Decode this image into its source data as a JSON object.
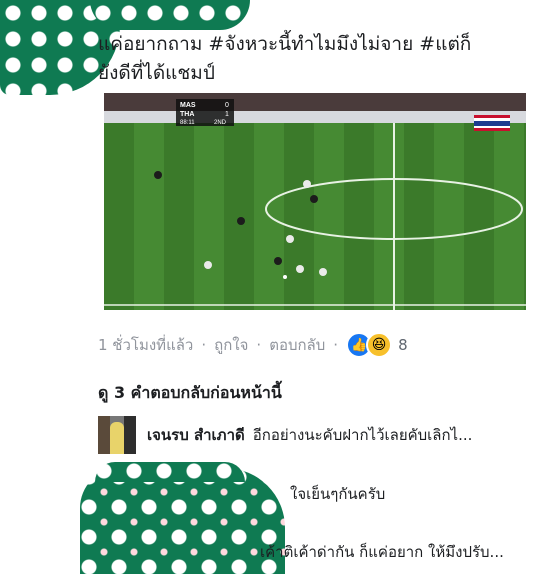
{
  "comment": {
    "text_line1_plain": "แค่อยากถาม ",
    "tag1": "#จังหวะนี้ทำไมมึงไม่จาย",
    "tag2": " #แต่ก็",
    "text_line2": "ยังดีที่ได้แชมป์"
  },
  "video": {
    "score_team1": "MAS",
    "score_val1": "0",
    "score_team2": "THA",
    "score_val2": "1",
    "time": "88:11",
    "half": "2ND"
  },
  "meta": {
    "time_ago": "1 ชั่วโมงที่แล้ว",
    "like": "ถูกใจ",
    "reply": "ตอบกลับ",
    "like_icon": "👍",
    "haha_icon": "😆",
    "reaction_count": "8"
  },
  "previous_replies": "ดู 3 คำตอบกลับก่อนหน้านี้",
  "replies": [
    {
      "name": "เจนรบ สำเภาดี",
      "text": "อีกอย่างนะคับฝากไว้เลยคับเลิกไ..."
    },
    {
      "text": "ใจเย็นๆกันครับ"
    },
    {
      "text": "เค้าติเค้าด่ากัน ก็แค่อยาก ให้มึงปรับ..."
    }
  ],
  "colors": {
    "censor_green": "#0f7a52",
    "link_blue": "#1877f2",
    "meta_grey": "#90949c"
  }
}
